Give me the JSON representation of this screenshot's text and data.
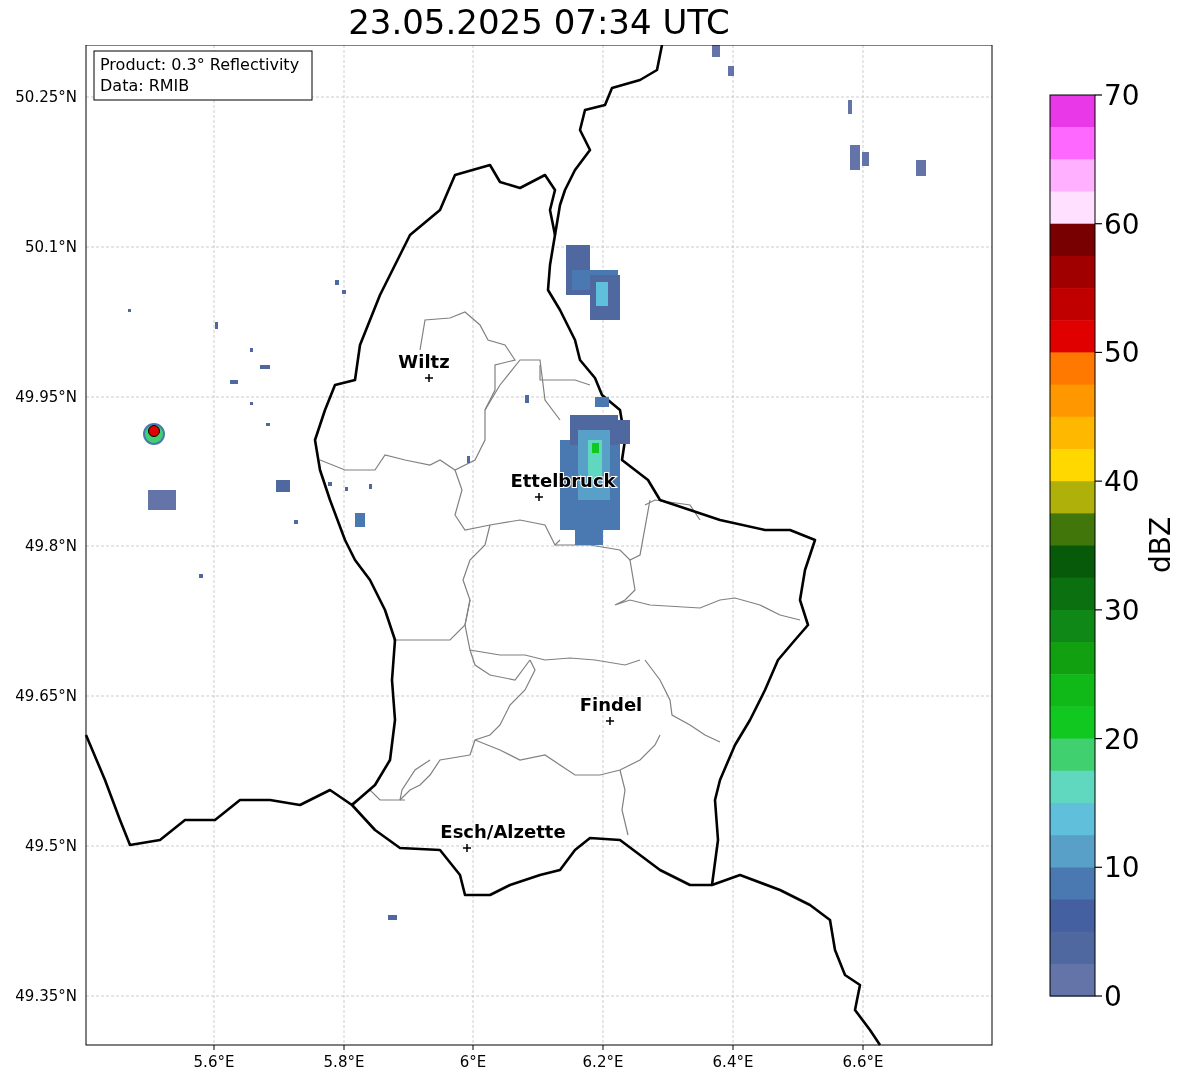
{
  "title": "23.05.2025 07:34 UTC",
  "map": {
    "info_box": [
      "Product: 0.3° Reflectivity",
      "Data: RMIB"
    ],
    "x_ticks": [
      "5.6°E",
      "5.8°E",
      "6°E",
      "6.2°E",
      "6.4°E",
      "6.6°E"
    ],
    "y_ticks": [
      "50.25°N",
      "50.1°N",
      "49.95°N",
      "49.8°N",
      "49.65°N",
      "49.5°N",
      "49.35°N"
    ],
    "places": [
      {
        "name": "Wiltz"
      },
      {
        "name": "Ettelbruck"
      },
      {
        "name": "Findel"
      },
      {
        "name": "Esch/Alzette"
      }
    ]
  },
  "colorbar": {
    "label": "dBZ",
    "ticks": [
      "70",
      "60",
      "50",
      "40",
      "30",
      "20",
      "10",
      "0"
    ],
    "bands": [
      {
        "color": "#e838e8"
      },
      {
        "color": "#ff68ff"
      },
      {
        "color": "#ffb0ff"
      },
      {
        "color": "#ffe0ff"
      },
      {
        "color": "#780000"
      },
      {
        "color": "#a00000"
      },
      {
        "color": "#c00000"
      },
      {
        "color": "#e00000"
      },
      {
        "color": "#ff7800"
      },
      {
        "color": "#ff9800"
      },
      {
        "color": "#ffb800"
      },
      {
        "color": "#ffd800"
      },
      {
        "color": "#b0b00a"
      },
      {
        "color": "#40760a"
      },
      {
        "color": "#065a0a"
      },
      {
        "color": "#0a7010"
      },
      {
        "color": "#108818"
      },
      {
        "color": "#10a010"
      },
      {
        "color": "#10b818"
      },
      {
        "color": "#10c820"
      },
      {
        "color": "#40d070"
      },
      {
        "color": "#60d8c0"
      },
      {
        "color": "#60c0dc"
      },
      {
        "color": "#58a0c8"
      },
      {
        "color": "#4a78b0"
      },
      {
        "color": "#4560a0"
      },
      {
        "color": "#5068a0"
      },
      {
        "color": "#6474a8"
      }
    ]
  }
}
